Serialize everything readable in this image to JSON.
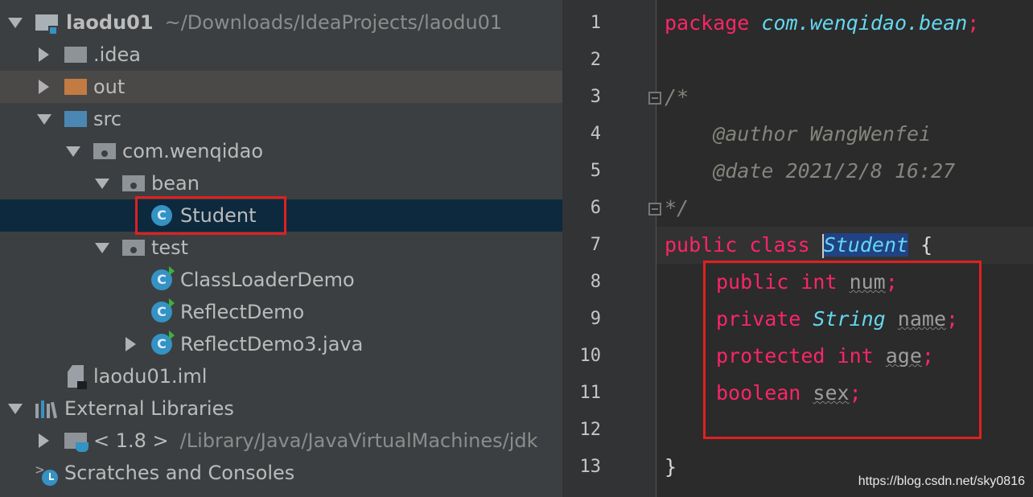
{
  "project": {
    "name": "laodu01",
    "path": "~/Downloads/IdeaProjects/laodu01"
  },
  "tree": {
    "idea": ".idea",
    "out": "out",
    "src": "src",
    "pkg_root": "com.wenqidao",
    "pkg_bean": "bean",
    "student": "Student",
    "pkg_test": "test",
    "class_loader_demo": "ClassLoaderDemo",
    "reflect_demo": "ReflectDemo",
    "reflect_demo3": "ReflectDemo3.java",
    "iml": "laodu01.iml",
    "external_libraries": "External Libraries",
    "jdk_label": "< 1.8 >",
    "jdk_path": "/Library/Java/JavaVirtualMachines/jdk",
    "scratches": "Scratches and Consoles",
    "class_letter": "C"
  },
  "editor": {
    "line_numbers": [
      "1",
      "2",
      "3",
      "4",
      "5",
      "6",
      "7",
      "8",
      "9",
      "10",
      "11",
      "12",
      "13"
    ],
    "l1_kw": "package",
    "l1_pkg": "com.wenqidao.bean",
    "semi": ";",
    "l3": "/*",
    "l4": "    @author WangWenfei",
    "l5": "    @date 2021/2/8 16:27",
    "l6": "*/",
    "l7_kw": "public class",
    "l7_cls": "Student",
    "l7_brace": "{",
    "l8_kw": "public int",
    "l8_var": "num",
    "l9_kw": "private",
    "l9_type": "String",
    "l9_var": "name",
    "l10_kw": "protected int",
    "l10_var": "age",
    "l11_kw": "boolean",
    "l11_var": "sex",
    "l13": "}"
  },
  "watermark": "https://blog.csdn.net/sky0816"
}
